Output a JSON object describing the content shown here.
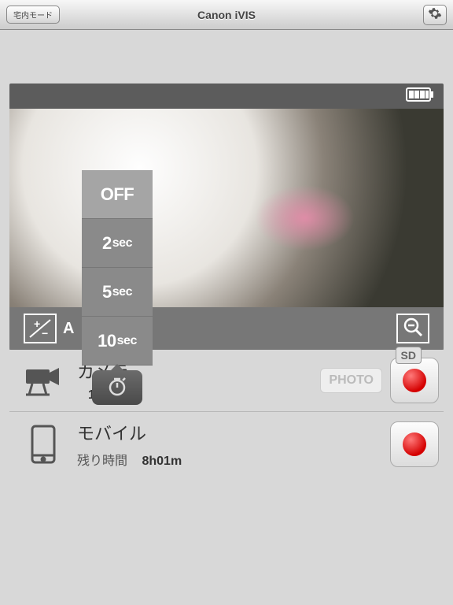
{
  "toolbar": {
    "mode_label": "宅内モード",
    "title": "Canon iVIS"
  },
  "timer": {
    "options": [
      "OFF",
      "2",
      "5",
      "10"
    ],
    "unit": "sec"
  },
  "status": {
    "ev_label": "A"
  },
  "camera": {
    "title": "カメラ",
    "remaining_label": "",
    "remaining_value": "15h26m",
    "storage": "SD",
    "photo_label": "PHOTO"
  },
  "mobile": {
    "title": "モバイル",
    "remaining_label": "残り時間",
    "remaining_value": "8h01m"
  }
}
